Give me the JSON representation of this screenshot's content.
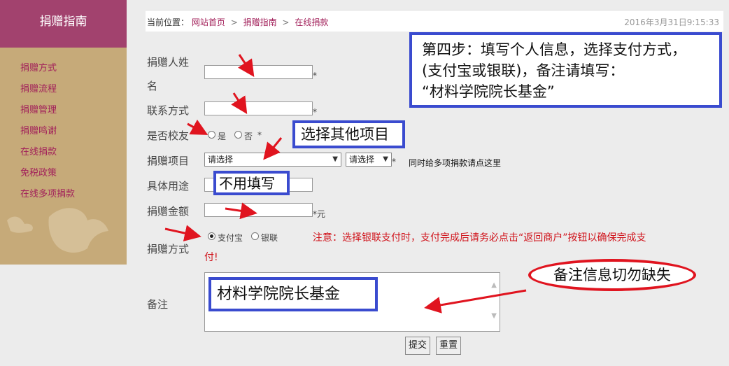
{
  "sidebar": {
    "title": "捐赠指南",
    "items": [
      {
        "label": "捐赠方式"
      },
      {
        "label": "捐赠流程"
      },
      {
        "label": "捐赠管理"
      },
      {
        "label": "捐赠鸣谢"
      },
      {
        "label": "在线捐款"
      },
      {
        "label": "免税政策"
      },
      {
        "label": "在线多项捐款"
      }
    ]
  },
  "breadcrumb": {
    "prefix": "当前位置：",
    "links": [
      "网站首页",
      "捐赠指南",
      "在线捐款"
    ],
    "separator": ">",
    "datetime": "2016年3月31日9:15:33"
  },
  "form": {
    "donor_name_label_line1": "捐赠人姓",
    "donor_name_label_line2": "名",
    "contact_label": "联系方式",
    "alumni_label": "是否校友",
    "alumni_yes": "是",
    "alumni_no": "否",
    "project_label": "捐赠项目",
    "project_select_value": "请选择",
    "project_sub_select_value": "请选择",
    "multi_project_link": "同时给多项捐款请点这里",
    "purpose_label": "具体用途",
    "amount_label": "捐赠金额",
    "amount_unit": "*元",
    "method_label": "捐赠方式",
    "method_alipay": "支付宝",
    "method_unionpay": "银联",
    "method_notice_line1": "注意：选择银联支付时，支付完成后请务必点击“返回商户”按钮以确保完成支",
    "method_notice_line2": "付!",
    "memo_label": "备注",
    "required_mark": "*",
    "submit_label": "提交",
    "reset_label": "重置"
  },
  "annotations": {
    "step4_line1": "第四步：填写个人信息，选择支付方式，",
    "step4_line2": "(支付宝或银联)，备注请填写：",
    "step4_line3": "“材料学院院长基金”",
    "choose_other": "选择其他项目",
    "no_fill": "不用填写",
    "memo_content": "材料学院院长基金",
    "memo_warning": "备注信息切勿缺失"
  },
  "colors": {
    "sidebar_header": "#a2426e",
    "sidebar_bg": "#c6aa79",
    "link": "#a2205a",
    "annotation_blue": "#3a4bcf",
    "annotation_red": "#e0141f",
    "notice_red": "#d0121a"
  }
}
